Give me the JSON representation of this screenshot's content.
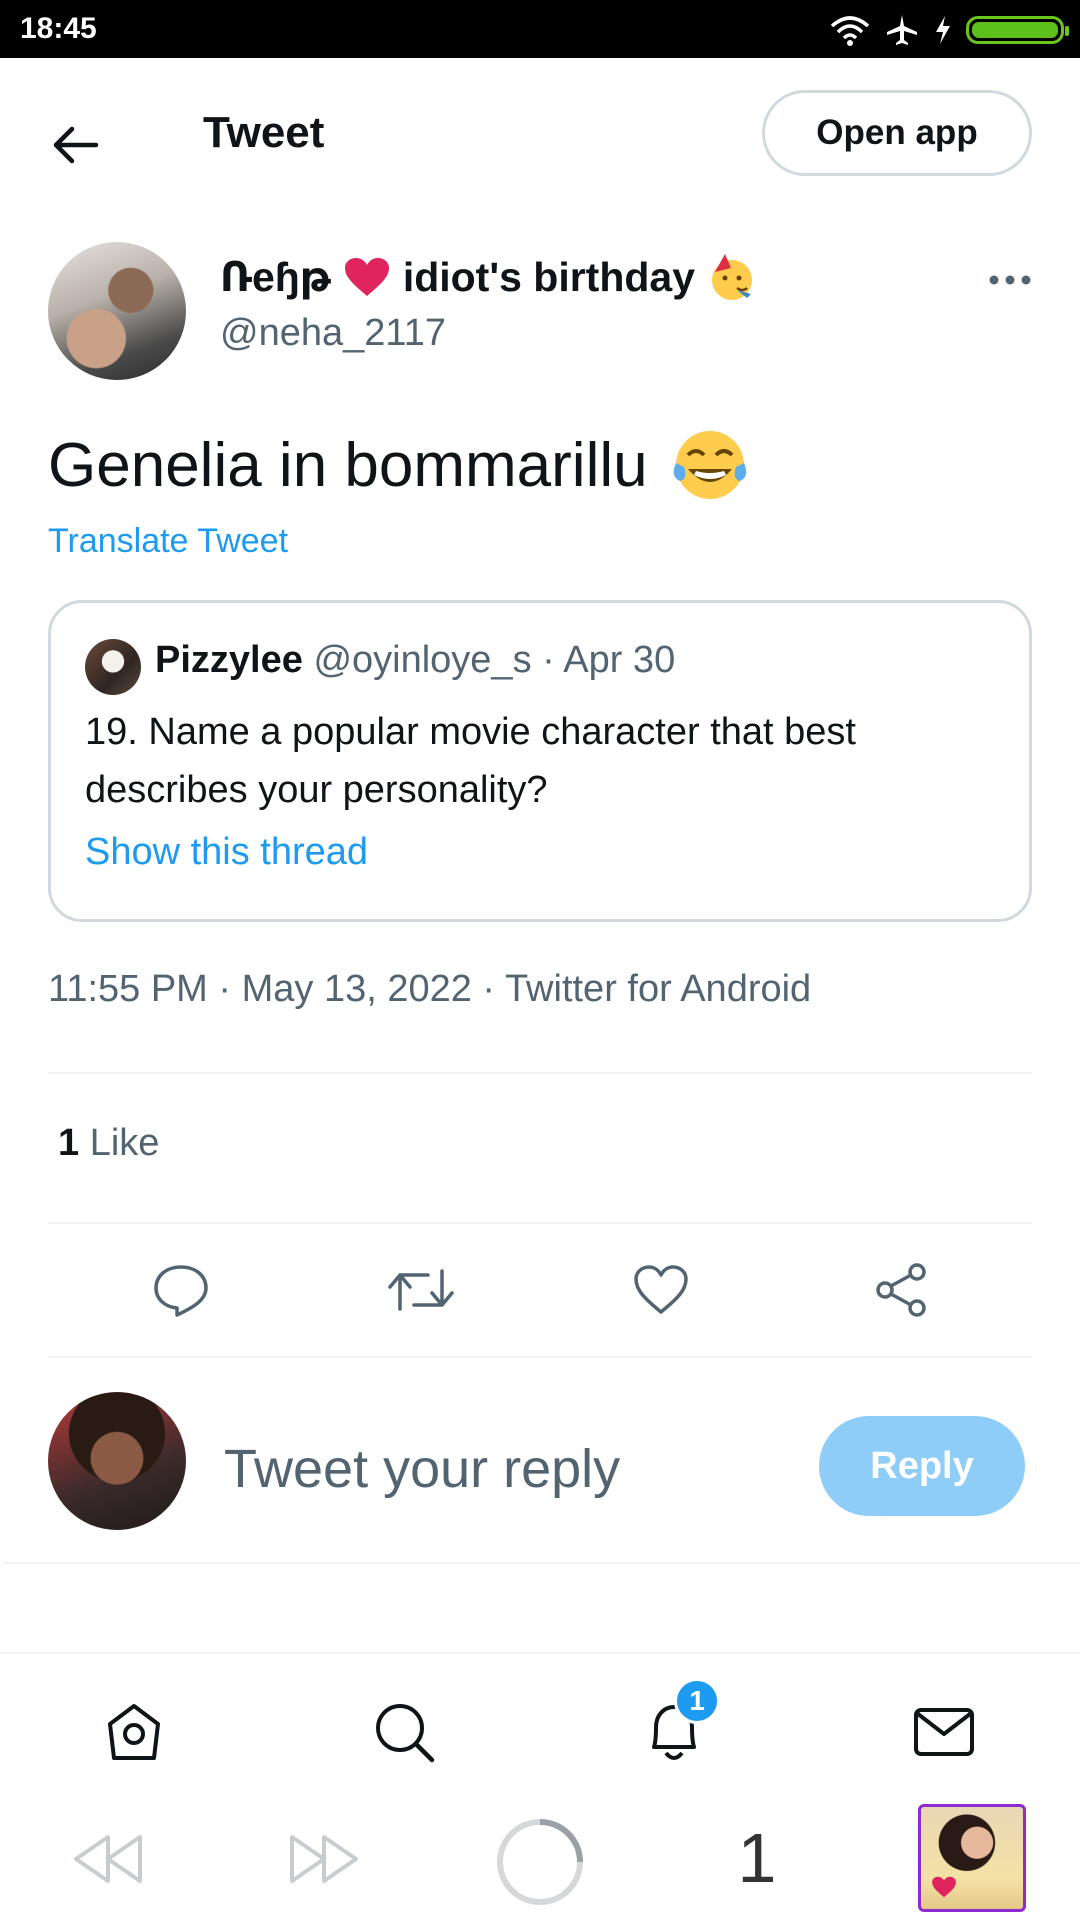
{
  "status_bar": {
    "time": "18:45"
  },
  "header": {
    "title": "Tweet",
    "open_app_label": "Open app"
  },
  "tweet": {
    "author_name": "Ռeɧթ",
    "author_name_suffix": "idiot's birthday",
    "author_handle": "@neha_2117",
    "text": "Genelia in bommarillu",
    "translate_label": "Translate Tweet",
    "timestamp": "11:55 PM · May 13, 2022 · Twitter for Android",
    "like_count": "1",
    "like_label": "Like"
  },
  "quote": {
    "name": "Pizzylee",
    "meta": "@oyinloye_s · Apr 30",
    "text": "19. Name a popular movie character that best describes your personality?",
    "link_label": "Show this thread"
  },
  "reply": {
    "placeholder": "Tweet your reply",
    "button_label": "Reply"
  },
  "bottom_nav": {
    "notification_badge": "1"
  },
  "browser_nav": {
    "tab_count": "1"
  },
  "colors": {
    "accent": "#1d9bf0",
    "reply_button": "#8ecdf8",
    "battery": "#5dc01b"
  }
}
